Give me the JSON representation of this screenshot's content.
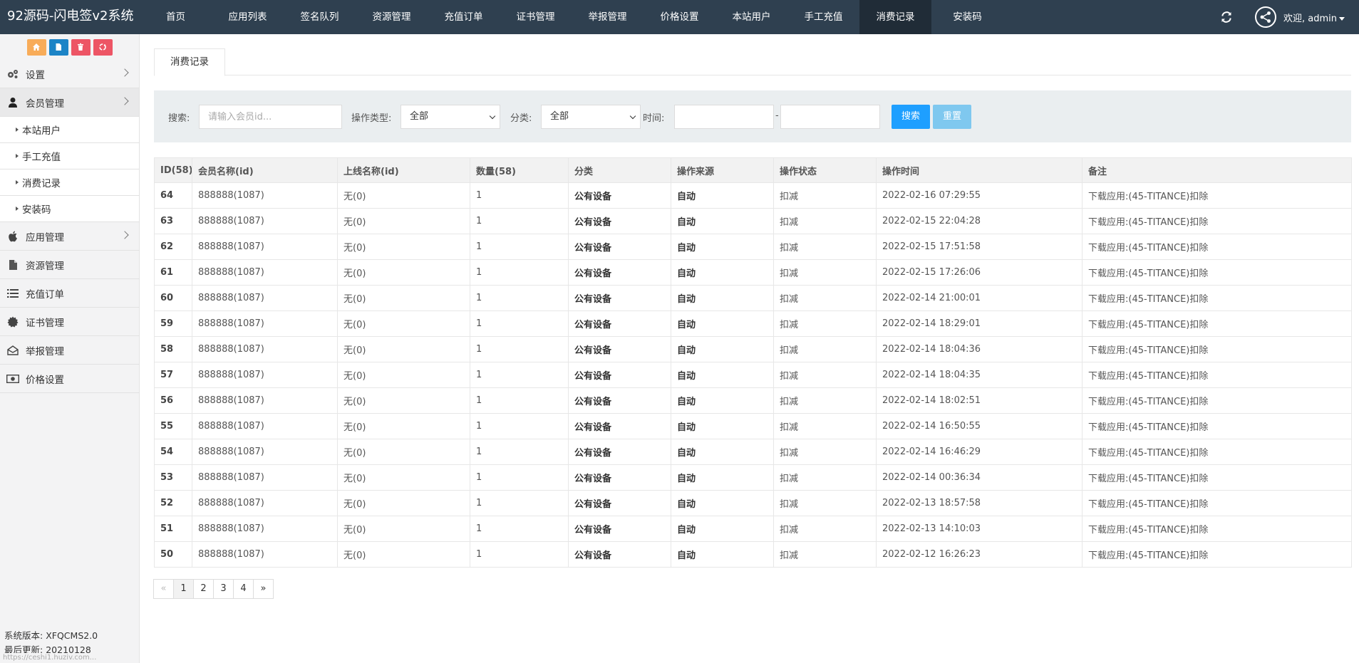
{
  "brand": "92源码-闪电签v2系统",
  "nav": [
    {
      "label": "首页",
      "active": false
    },
    {
      "label": "应用列表",
      "active": false
    },
    {
      "label": "签名队列",
      "active": false
    },
    {
      "label": "资源管理",
      "active": false
    },
    {
      "label": "充值订单",
      "active": false
    },
    {
      "label": "证书管理",
      "active": false
    },
    {
      "label": "举报管理",
      "active": false
    },
    {
      "label": "价格设置",
      "active": false
    },
    {
      "label": "本站用户",
      "active": false
    },
    {
      "label": "手工充值",
      "active": false
    },
    {
      "label": "消费记录",
      "active": true
    },
    {
      "label": "安装码",
      "active": false
    }
  ],
  "user": {
    "welcome": "欢迎, admin"
  },
  "quick_buttons": [
    {
      "icon": "home-icon",
      "color": "#f8ac59"
    },
    {
      "icon": "file-icon",
      "color": "#1c84c6"
    },
    {
      "icon": "trash-icon",
      "color": "#ed5565"
    },
    {
      "icon": "recycle-icon",
      "color": "#ed5565"
    }
  ],
  "sidebar": {
    "settings": "设置",
    "members": "会员管理",
    "member_subs": [
      "本站用户",
      "手工充值",
      "消费记录",
      "安装码"
    ],
    "apps": "应用管理",
    "resources": "资源管理",
    "orders": "充值订单",
    "certs": "证书管理",
    "reports": "举报管理",
    "prices": "价格设置"
  },
  "footer": {
    "version_label": "系统版本:",
    "version_value": "XFQCMS2.0",
    "updated_label": "最后更新:",
    "updated_value": "20210128",
    "status_url": "https://ceshi1.huziv.com..."
  },
  "tab": {
    "label": "消费记录"
  },
  "search": {
    "label": "搜索:",
    "placeholder": "请输入会员id...",
    "op_type_label": "操作类型:",
    "op_type_value": "全部",
    "category_label": "分类:",
    "category_value": "全部",
    "time_label": "时间:",
    "dash": "-",
    "search_btn": "搜索",
    "reset_btn": "重置"
  },
  "table": {
    "headers": [
      "ID(58)",
      "会员名称(id)",
      "上线名称(id)",
      "数量(58)",
      "分类",
      "操作来源",
      "操作状态",
      "操作时间",
      "备注"
    ],
    "rows": [
      [
        "64",
        "888888(1087)",
        "无(0)",
        "1",
        "公有设备",
        "自动",
        "扣减",
        "2022-02-16 07:29:55",
        "下载应用:(45-TITANCE)扣除"
      ],
      [
        "63",
        "888888(1087)",
        "无(0)",
        "1",
        "公有设备",
        "自动",
        "扣减",
        "2022-02-15 22:04:28",
        "下载应用:(45-TITANCE)扣除"
      ],
      [
        "62",
        "888888(1087)",
        "无(0)",
        "1",
        "公有设备",
        "自动",
        "扣减",
        "2022-02-15 17:51:58",
        "下载应用:(45-TITANCE)扣除"
      ],
      [
        "61",
        "888888(1087)",
        "无(0)",
        "1",
        "公有设备",
        "自动",
        "扣减",
        "2022-02-15 17:26:06",
        "下载应用:(45-TITANCE)扣除"
      ],
      [
        "60",
        "888888(1087)",
        "无(0)",
        "1",
        "公有设备",
        "自动",
        "扣减",
        "2022-02-14 21:00:01",
        "下载应用:(45-TITANCE)扣除"
      ],
      [
        "59",
        "888888(1087)",
        "无(0)",
        "1",
        "公有设备",
        "自动",
        "扣减",
        "2022-02-14 18:29:01",
        "下载应用:(45-TITANCE)扣除"
      ],
      [
        "58",
        "888888(1087)",
        "无(0)",
        "1",
        "公有设备",
        "自动",
        "扣减",
        "2022-02-14 18:04:36",
        "下载应用:(45-TITANCE)扣除"
      ],
      [
        "57",
        "888888(1087)",
        "无(0)",
        "1",
        "公有设备",
        "自动",
        "扣减",
        "2022-02-14 18:04:35",
        "下载应用:(45-TITANCE)扣除"
      ],
      [
        "56",
        "888888(1087)",
        "无(0)",
        "1",
        "公有设备",
        "自动",
        "扣减",
        "2022-02-14 18:02:51",
        "下载应用:(45-TITANCE)扣除"
      ],
      [
        "55",
        "888888(1087)",
        "无(0)",
        "1",
        "公有设备",
        "自动",
        "扣减",
        "2022-02-14 16:50:55",
        "下载应用:(45-TITANCE)扣除"
      ],
      [
        "54",
        "888888(1087)",
        "无(0)",
        "1",
        "公有设备",
        "自动",
        "扣减",
        "2022-02-14 16:46:29",
        "下载应用:(45-TITANCE)扣除"
      ],
      [
        "53",
        "888888(1087)",
        "无(0)",
        "1",
        "公有设备",
        "自动",
        "扣减",
        "2022-02-14 00:36:34",
        "下载应用:(45-TITANCE)扣除"
      ],
      [
        "52",
        "888888(1087)",
        "无(0)",
        "1",
        "公有设备",
        "自动",
        "扣减",
        "2022-02-13 18:57:58",
        "下载应用:(45-TITANCE)扣除"
      ],
      [
        "51",
        "888888(1087)",
        "无(0)",
        "1",
        "公有设备",
        "自动",
        "扣减",
        "2022-02-13 14:10:03",
        "下载应用:(45-TITANCE)扣除"
      ],
      [
        "50",
        "888888(1087)",
        "无(0)",
        "1",
        "公有设备",
        "自动",
        "扣减",
        "2022-02-12 16:26:23",
        "下载应用:(45-TITANCE)扣除"
      ]
    ]
  },
  "pagination": {
    "prev": "«",
    "pages": [
      "1",
      "2",
      "3",
      "4"
    ],
    "current": "1",
    "next": "»"
  },
  "colors": {
    "topbar": "#2f4050",
    "nav_active": "#202c37",
    "search_button": "#1e9fff",
    "reset_button": "#7fc8ef",
    "searchbar_bg": "#eaeef0"
  }
}
